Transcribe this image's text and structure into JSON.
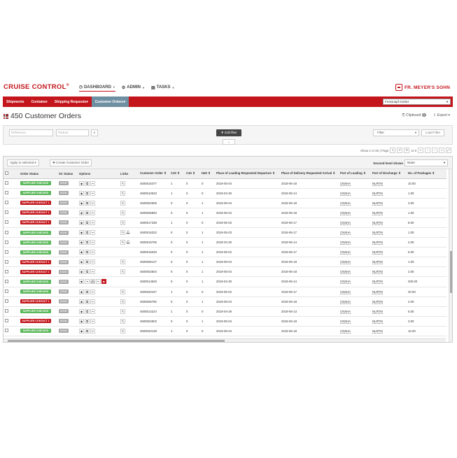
{
  "header": {
    "brand": "CRUISE CONTROL",
    "brand_mark": "®",
    "nav": [
      {
        "label": "DASHBOARD",
        "icon": "dashboard-icon",
        "glyph": "◷"
      },
      {
        "label": "ADMIN",
        "icon": "gear-icon",
        "glyph": "⚙"
      },
      {
        "label": "TASKS",
        "icon": "tasks-icon",
        "glyph": "▤"
      }
    ],
    "logo_text": "FR. MEYER'S SOHN"
  },
  "rednav": {
    "items": [
      "Shipments",
      "Container",
      "Shipping Requests",
      "Customer Orders"
    ],
    "active": "Customer Orders",
    "company": "Fressnapf GmbH"
  },
  "page": {
    "title": "450 Customer Orders",
    "clipboard": "Clipboard",
    "clipboard_count": "0",
    "export": "Export"
  },
  "filter": {
    "reference_placeholder": "Reference",
    "partner_placeholder": "Partner",
    "edit_filter": "Edit filter",
    "filter_select": "Filter",
    "load_filter": "Load Filter"
  },
  "pagination": {
    "show": "Show 1 to 50 | Page",
    "page": "1",
    "of": "of",
    "total_pages": "9",
    "to": "to 9"
  },
  "toolbar": {
    "apply_label": "Apply to selected",
    "create_label": "Create Customer Order",
    "second_level_label": "Second level shows",
    "second_level_value": "None"
  },
  "table": {
    "columns": [
      "",
      "Order Status",
      "SC Status",
      "Options",
      "Links",
      "Customer Order",
      "C20",
      "C40",
      "H40",
      "Place of Loading Requested Departure",
      "Place of Delivery Requested Arrival",
      "Port of Loading",
      "Port of Discharge",
      "No. of Packages"
    ],
    "sc_label": "NONE",
    "rows": [
      {
        "status": "SUPPLIER CHECKED",
        "color": "green",
        "order": "4500516377",
        "c20": "1",
        "c40": "0",
        "h40": "0",
        "dep": "2019-05-04",
        "arr": "2019-06-18",
        "pol": "CNSHA",
        "pod": "NLRTM",
        "pkgs": "10.00",
        "links": "edit"
      },
      {
        "status": "SUPPLIER CHECKED",
        "color": "green",
        "order": "4500510533",
        "c20": "1",
        "c40": "0",
        "h40": "0",
        "dep": "2019-04-30",
        "arr": "2019-06-14",
        "pol": "CNSHA",
        "pod": "NLRTM",
        "pkgs": "1.00",
        "links": "edit"
      },
      {
        "status": "SUPPLIER CONTACT 1",
        "color": "red",
        "order": "4500502505",
        "c20": "0",
        "c40": "0",
        "h40": "1",
        "dep": "2019-05-04",
        "arr": "2019-06-18",
        "pol": "CNSHA",
        "pod": "NLRTM",
        "pkgs": "3.00",
        "links": "edit"
      },
      {
        "status": "SUPPLIER CONTACT 1",
        "color": "red",
        "order": "4500505893",
        "c20": "0",
        "c40": "0",
        "h40": "1",
        "dep": "2019-05-04",
        "arr": "2019-06-18",
        "pol": "CNSHA",
        "pod": "NLRTM",
        "pkgs": "1.00",
        "links": "edit"
      },
      {
        "status": "SUPPLIER CONTACT 1",
        "color": "red",
        "order": "4500517338",
        "c20": "1",
        "c40": "0",
        "h40": "0",
        "dep": "2019-05-03",
        "arr": "2019-06-17",
        "pol": "CNSHA",
        "pod": "NLRTM",
        "pkgs": "8.00",
        "links": "edit"
      },
      {
        "status": "SUPPLIER CHECKED",
        "color": "green",
        "order": "4500515322",
        "c20": "0",
        "c40": "0",
        "h40": "1",
        "dep": "2019-05-03",
        "arr": "2019-06-17",
        "pol": "CNSHA",
        "pod": "NLRTM",
        "pkgs": "1.00",
        "links": "edit-bell"
      },
      {
        "status": "SUPPLIER CHECKED",
        "color": "green",
        "order": "4500515706",
        "c20": "0",
        "c40": "0",
        "h40": "1",
        "dep": "2019-04-30",
        "arr": "2019-06-14",
        "pol": "CNSHA",
        "pod": "NLRTM",
        "pkgs": "2.00",
        "links": "edit-bell"
      },
      {
        "status": "SUPPLIER CHECKED",
        "color": "green",
        "order": "4500515045",
        "c20": "0",
        "c40": "0",
        "h40": "1",
        "dep": "2019-05-02",
        "arr": "2019-06-17",
        "pol": "CNSHA",
        "pod": "NLRTM",
        "pkgs": "5.00",
        "links": "none"
      },
      {
        "status": "SUPPLIER CONTACT 1",
        "color": "red",
        "order": "4500506127",
        "c20": "0",
        "c40": "0",
        "h40": "1",
        "dep": "2019-05-04",
        "arr": "2019-06-18",
        "pol": "CNSHA",
        "pod": "NLRTM",
        "pkgs": "1.00",
        "links": "edit"
      },
      {
        "status": "SUPPLIER CONTACT 1",
        "color": "red",
        "order": "4500502504",
        "c20": "0",
        "c40": "0",
        "h40": "1",
        "dep": "2019-05-04",
        "arr": "2019-06-18",
        "pol": "CNSHA",
        "pod": "NLRTM",
        "pkgs": "2.00",
        "links": "edit"
      },
      {
        "status": "SUPPLIER CHECKED",
        "color": "green",
        "order": "4500514526",
        "c20": "0",
        "c40": "0",
        "h40": "1",
        "dep": "2019-04-30",
        "arr": "2019-06-14",
        "pol": "CNSHA",
        "pod": "NLRTM",
        "pkgs": "200.00",
        "links": "none",
        "extended": true
      },
      {
        "status": "SUPPLIER CHECKED",
        "color": "green",
        "order": "4500520447",
        "c20": "1",
        "c40": "0",
        "h40": "0",
        "dep": "2019-05-02",
        "arr": "2019-06-17",
        "pol": "CNSHA",
        "pod": "NLRTM",
        "pkgs": "20.00",
        "links": "edit"
      },
      {
        "status": "SUPPLIER CONTACT 1",
        "color": "red",
        "order": "4500506780",
        "c20": "0",
        "c40": "0",
        "h40": "1",
        "dep": "2019-05-04",
        "arr": "2019-06-18",
        "pol": "CNSHA",
        "pod": "NLRTM",
        "pkgs": "2.00",
        "links": "edit"
      },
      {
        "status": "SUPPLIER CHECKED",
        "color": "green",
        "order": "4500514224",
        "c20": "1",
        "c40": "0",
        "h40": "0",
        "dep": "2019-04-29",
        "arr": "2019-06-13",
        "pol": "CNSHA",
        "pod": "NLRTM",
        "pkgs": "6.00",
        "links": "edit"
      },
      {
        "status": "SUPPLIER CONTACT 1",
        "color": "red",
        "order": "4500502503",
        "c20": "0",
        "c40": "0",
        "h40": "1",
        "dep": "2019-05-04",
        "arr": "2019-06-18",
        "pol": "CNSHA",
        "pod": "NLRTM",
        "pkgs": "3.00",
        "links": "edit"
      },
      {
        "status": "SUPPLIER CHECKED",
        "color": "green",
        "order": "4500520139",
        "c20": "1",
        "c40": "0",
        "h40": "0",
        "dep": "2019-05-04",
        "arr": "2019-06-18",
        "pol": "CNSHA",
        "pod": "NLRTM",
        "pkgs": "10.00",
        "links": "edit"
      }
    ]
  },
  "colors": {
    "brand_red": "#c3151b",
    "nav_active": "#6e8fa1",
    "green": "#5cb85c"
  }
}
